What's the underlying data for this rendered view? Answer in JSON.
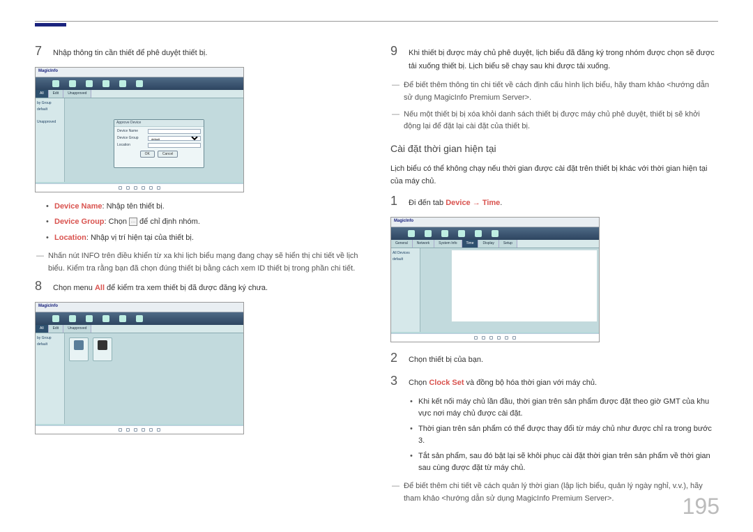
{
  "page_number": "195",
  "screenshot_branding": "MagicInfo",
  "left": {
    "step7": {
      "num": "7",
      "text": "Nhập thông tin cần thiết để phê duyệt thiết bị."
    },
    "dialog": {
      "title": "Approve Device",
      "row1_label": "Device Name",
      "row2_label": "Device Group",
      "row2_value": "default",
      "row3_label": "Location",
      "btn_ok": "OK",
      "btn_cancel": "Cancel"
    },
    "bullets": {
      "b1_label": "Device Name",
      "b1_text": ": Nhập tên thiết bị.",
      "b2_label": "Device Group",
      "b2_text_pre": ": Chọn ",
      "b2_text_post": " để chỉ định nhóm.",
      "b3_label": "Location",
      "b3_text": ": Nhập vị trí hiện tại của thiết bị."
    },
    "note_info": "Nhấn nút INFO trên điều khiển từ xa khi lịch biểu mạng đang chạy sẽ hiển thị chi tiết về lịch biểu. Kiểm tra rằng bạn đã chọn đúng thiết bị bằng cách xem ID thiết bị trong phần chi tiết.",
    "step8": {
      "num": "8",
      "text_pre": "Chọn menu ",
      "text_em": "All",
      "text_post": " để kiểm tra xem thiết bị đã được đăng ký chưa."
    }
  },
  "right": {
    "step9": {
      "num": "9",
      "text": "Khi thiết bị được máy chủ phê duyệt, lịch biểu đã đăng ký trong nhóm được chọn sẽ được tải xuống thiết bị. Lịch biểu sẽ chạy sau khi được tải xuống."
    },
    "note1": "Để biết thêm thông tin chi tiết về cách định cấu hình lịch biểu, hãy tham khảo <hướng dẫn sử dụng MagicInfo Premium Server>.",
    "note2": "Nếu một thiết bị bị xóa khỏi danh sách thiết bị được máy chủ phê duyệt, thiết bị sẽ khởi động lại để đặt lại cài đặt của thiết bị.",
    "subheading": "Cài đặt thời gian hiện tại",
    "sub_intro": "Lịch biểu có thể không chạy nếu thời gian được cài đặt trên thiết bị khác với thời gian hiện tại của máy chủ.",
    "step1": {
      "num": "1",
      "text_pre": "Đi đến tab ",
      "text_em1": "Device",
      "text_arrow": " → ",
      "text_em2": "Time",
      "text_post": "."
    },
    "step2": {
      "num": "2",
      "text": "Chọn thiết bị của bạn."
    },
    "step3": {
      "num": "3",
      "text_pre": "Chọn ",
      "text_em": "Clock Set",
      "text_post": " và đồng bộ hóa thời gian với máy chủ."
    },
    "sub_bullets": {
      "b1": "Khi kết nối máy chủ lần đầu, thời gian trên sản phẩm được đặt theo giờ GMT của khu vực nơi máy chủ được cài đặt.",
      "b2": "Thời gian trên sản phẩm có thể được thay đổi từ máy chủ như được chỉ ra trong bước 3.",
      "b3": "Tắt sản phẩm, sau đó bật lại sẽ khôi phục cài đặt thời gian trên sản phẩm về thời gian sau cùng được đặt từ máy chủ."
    },
    "note3": "Để biết thêm chi tiết về cách quản lý thời gian (lập lịch biểu, quản lý ngày nghỉ, v.v.), hãy tham khảo <hướng dẫn sử dụng MagicInfo Premium Server>."
  }
}
